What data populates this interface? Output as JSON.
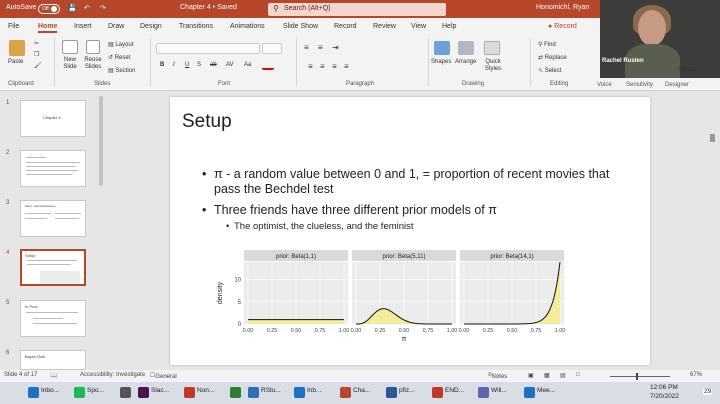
{
  "titlebar": {
    "autosave": "AutoSave",
    "autosave_state": "Off",
    "doc_title": "Chapter 4 • Saved",
    "search_placeholder": "Search (Alt+Q)",
    "user": "Honomichl, Ryan"
  },
  "tabs": [
    "File",
    "Home",
    "Insert",
    "Draw",
    "Design",
    "Transitions",
    "Animations",
    "Slide Show",
    "Record",
    "Review",
    "View",
    "Help"
  ],
  "active_tab": "Home",
  "record_label": "Record",
  "ribbon": {
    "paste": "Paste",
    "new_slide": "New Slide",
    "reuse_slides": "Reuse Slides",
    "layout": "Layout",
    "reset": "Reset",
    "section": "Section",
    "font_buttons": [
      "B",
      "I",
      "U",
      "S",
      "ab",
      "AV",
      "Aa"
    ],
    "shapes": "Shapes",
    "arrange": "Arrange",
    "quick_styles": "Quick Styles",
    "find": "Find",
    "replace": "Replace",
    "select": "Select",
    "ideas": "Ideas",
    "groups": [
      "Clipboard",
      "Slides",
      "Font",
      "Paragraph",
      "Drawing",
      "Editing",
      "Voice",
      "Sensitivity",
      "Designer"
    ]
  },
  "video": {
    "name": "Rachel Rusten"
  },
  "thumbnails": [
    {
      "num": "1",
      "title": "Chapter 4"
    },
    {
      "num": "2",
      "title": ""
    },
    {
      "num": "3",
      "title": "Meet, optimist/clueless..."
    },
    {
      "num": "4",
      "title": "Setup"
    },
    {
      "num": "5",
      "title": "In Prior"
    },
    {
      "num": "6",
      "title": "Bayes Rule"
    }
  ],
  "selected_slide": "4",
  "slide": {
    "title": "Setup",
    "bullets": [
      "π - a random value between 0 and 1, = proportion of recent movies that pass the Bechdel test",
      "Three friends have three different prior models of π"
    ],
    "sub_bullet": "The optimist, the clueless, and the feminist"
  },
  "chart_data": {
    "type": "area",
    "ylabel": "density",
    "xlabel": "π",
    "x_ticks": [
      "0.00",
      "0.25",
      "0.50",
      "0.75",
      "1.00"
    ],
    "fill_color": "#f5eb9c",
    "panel_bg": "#ebebeb",
    "panels": [
      {
        "title": "prior: Beta(1,1)",
        "a": 1,
        "b": 1
      },
      {
        "title": "prior: Beta(5,11)",
        "a": 5,
        "b": 11
      },
      {
        "title": "prior: Beta(14,1)",
        "a": 14,
        "b": 1
      }
    ],
    "y_ticks": [
      "0",
      "5",
      "10"
    ],
    "ylim": [
      0,
      14
    ]
  },
  "status": {
    "slide_of": "Slide 4 of 17",
    "accessibility": "Accessibility: Investigate",
    "general": "General",
    "notes": "Notes",
    "zoom": "67%"
  },
  "taskbar": {
    "apps": [
      "Inbo...",
      "Spo...",
      "",
      "Slac...",
      "Non...",
      "",
      "RStu...",
      "Inb...",
      "Cha...",
      "pfiz...",
      "END...",
      "Will...",
      "Mee..."
    ],
    "time": "12:06 PM",
    "date": "7/20/2022",
    "badge": "29"
  }
}
